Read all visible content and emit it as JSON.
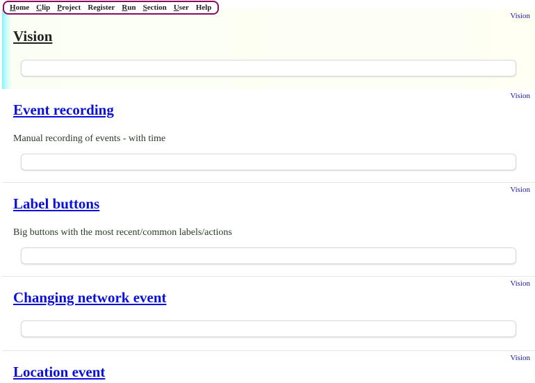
{
  "menu": [
    {
      "label": "Home",
      "key": "H",
      "rest": "ome"
    },
    {
      "label": "Clip",
      "key": "C",
      "rest": "lip"
    },
    {
      "label": "Project",
      "key": "P",
      "rest": "roject"
    },
    {
      "label": "Register",
      "key": "",
      "rest": "Register"
    },
    {
      "label": "Run",
      "key": "R",
      "rest": "un"
    },
    {
      "label": "Section",
      "key": "S",
      "rest": "ection"
    },
    {
      "label": "User",
      "key": "U",
      "rest": "ser"
    },
    {
      "label": "Help",
      "key": "",
      "rest": "Help"
    }
  ],
  "sections": [
    {
      "vision_link": "Vision",
      "title": "Vision",
      "description": ""
    },
    {
      "vision_link": "Vision",
      "title": "Event recording",
      "description": "Manual recording of events - with time"
    },
    {
      "vision_link": "Vision",
      "title": "Label buttons",
      "description": "Big buttons with the most recent/common labels/actions"
    },
    {
      "vision_link": "Vision",
      "title": "Changing network event",
      "description": ""
    },
    {
      "vision_link": "Vision",
      "title": "Location event",
      "description": ""
    }
  ]
}
